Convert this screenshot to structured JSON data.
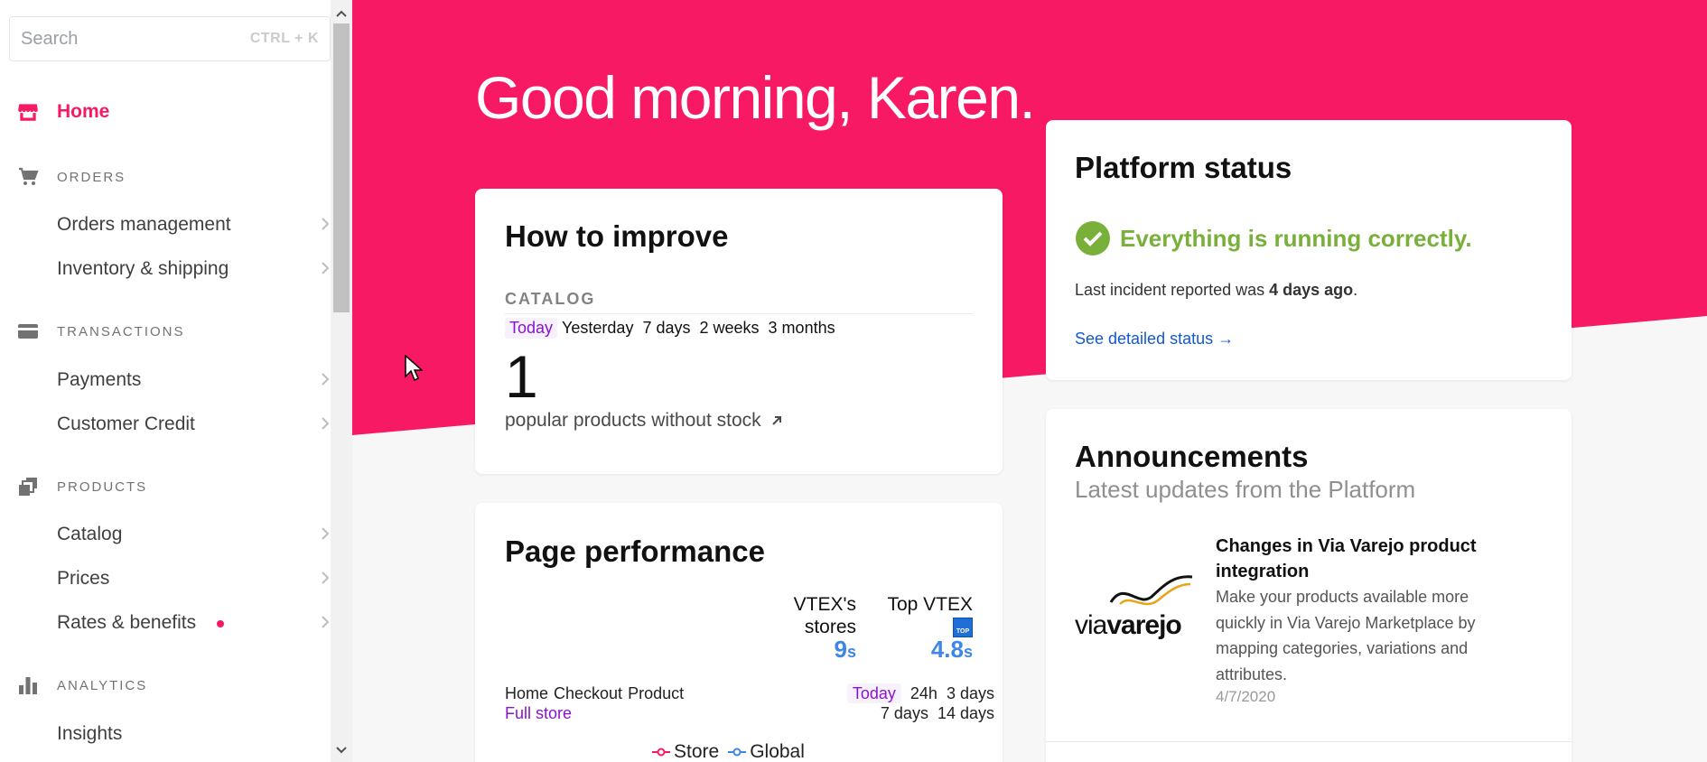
{
  "sidebar": {
    "search": {
      "placeholder": "Search",
      "shortcut": "CTRL + K"
    },
    "home": {
      "label": "Home",
      "icon": "store-icon"
    },
    "sections": [
      {
        "label": "ORDERS",
        "icon": "cart-icon",
        "items": [
          "Orders management",
          "Inventory & shipping"
        ]
      },
      {
        "label": "TRANSACTIONS",
        "icon": "credit-card-icon",
        "items": [
          "Payments",
          "Customer Credit"
        ]
      },
      {
        "label": "PRODUCTS",
        "icon": "products-icon",
        "items": [
          "Catalog",
          "Prices",
          "Rates & benefits"
        ]
      },
      {
        "label": "ANALYTICS",
        "icon": "bar-chart-icon",
        "items": [
          "Insights"
        ]
      }
    ]
  },
  "main": {
    "greeting": "Good morning, Karen.",
    "improve": {
      "title": "How to improve",
      "category": "CATALOG",
      "periods": [
        "Today",
        "Yesterday",
        "7 days",
        "2 weeks",
        "3 months"
      ],
      "active_period": "Today",
      "count": "1",
      "description": "popular products without stock"
    },
    "performance": {
      "title": "Page performance",
      "col1_label_a": "VTEX's",
      "col1_label_b": "stores",
      "col1_value": "9",
      "col2_label": "Top VTEX",
      "col2_badge": "TOP",
      "col2_value": "4.8",
      "unit": "s",
      "pages": [
        "Home",
        "Checkout",
        "Product",
        "Full store"
      ],
      "active_page": "Full store",
      "ranges": [
        "Today",
        "24h",
        "3 days",
        "7 days",
        "14 days"
      ],
      "active_range": "Today",
      "legend": [
        "Store",
        "Global"
      ]
    },
    "status": {
      "title": "Platform status",
      "message": "Everything is running correctly.",
      "last_prefix": "Last incident reported was ",
      "last_value": "4 days ago",
      "last_suffix": ".",
      "link": "See detailed status →"
    },
    "announcements": {
      "title": "Announcements",
      "subtitle": "Latest updates from the Platform",
      "item": {
        "title": "Changes in Via Varejo product integration",
        "text": "Make your products available more quickly in Via Varejo Marketplace by mapping categories, variations and attributes.",
        "date": "4/7/2020",
        "logo_text_a": "via",
        "logo_text_b": "varejo"
      }
    }
  },
  "colors": {
    "brand": "#f71963",
    "success": "#79b03a",
    "link": "#1358d0",
    "active": "#8914cc",
    "perf": "#3f86e6"
  }
}
